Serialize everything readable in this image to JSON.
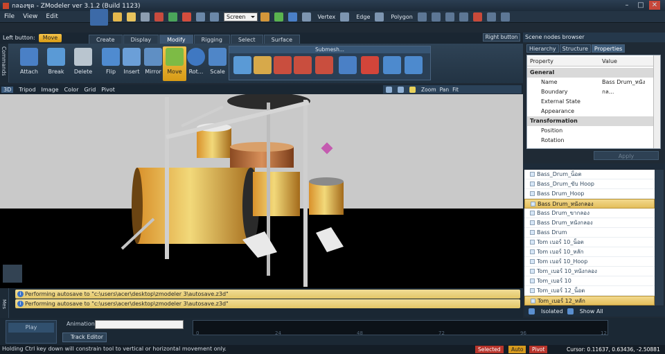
{
  "window": {
    "title": "กลองชุด - ZModeler ver 3.1.2 (Build 1123)"
  },
  "menu": [
    "File",
    "View",
    "Edit"
  ],
  "toolbar": {
    "screen_combo": "Screen",
    "selection_modes": [
      "Vertex",
      "Edge",
      "Polygon"
    ]
  },
  "left_button": {
    "label": "Left button:",
    "value": "Move"
  },
  "tabs": [
    "Create",
    "Display",
    "Modify",
    "Rigging",
    "Select",
    "Surface"
  ],
  "active_tab": "Modify",
  "right_button": "Right button",
  "commands_label": "Commands",
  "tools": [
    "Attach",
    "Break",
    "Delete",
    "Flip",
    "Insert",
    "Mirror",
    "Move",
    "Rot...",
    "Scale"
  ],
  "active_tool": "Move",
  "submesh_label": "Submesh...",
  "viewport_bar": [
    "3D",
    "Tripod",
    "Image",
    "Color",
    "Grid",
    "Pivot"
  ],
  "viewport_tools": [
    "Zoom",
    "Pan",
    "Fit"
  ],
  "log": [
    "Performing autosave to \"c:\\users\\acer\\desktop\\zmodeler 3\\autosave.z3d\"",
    "Performing autosave to \"c:\\users\\acer\\desktop\\zmodeler 3\\autosave.z3d\""
  ],
  "log_label": "Mes",
  "animation": {
    "play_label": "Play",
    "label": "Animation:",
    "track_editor": "Track Editor"
  },
  "timeline_ticks": [
    "0",
    "24",
    "48",
    "72",
    "96",
    "12"
  ],
  "status": {
    "message": "Holding Ctrl key down will constrain tool to vertical or horizontal movement only.",
    "selected": "Selected",
    "auto": "Auto",
    "pivot": "Pivot",
    "cursor": "Cursor: 0.11637, 0.63436, -2.50881"
  },
  "scene_browser": {
    "title": "Scene nodes browser",
    "tabs": [
      "Hierarchy",
      "Structure",
      "Properties"
    ],
    "active_tab": "Properties",
    "columns": [
      "Property",
      "Value"
    ],
    "props": [
      {
        "name": "General",
        "value": "",
        "group": true
      },
      {
        "name": "Name",
        "value": "Bass Drum_หนังกล...",
        "group": false
      },
      {
        "name": "Boundary",
        "value": "",
        "group": false
      },
      {
        "name": "External State",
        "value": "",
        "group": false
      },
      {
        "name": "Appearance",
        "value": "",
        "group": false
      },
      {
        "name": "Transformation",
        "value": "",
        "group": true
      },
      {
        "name": "Position",
        "value": "",
        "group": false
      },
      {
        "name": "Rotation",
        "value": "",
        "group": false
      }
    ],
    "apply": "Apply",
    "nodes": [
      "Bass_Drum_น็อต",
      "Bass_Drum_ขับ Hoop",
      "Bass Drum_Hoop",
      "Bass Drum_หนังกลอง",
      "Bass Drum_ขากลอง",
      "Bass Drum_หนังกลอง",
      "Bass Drum",
      "Tom เบอร์ 10_น็อต",
      "Tom เบอร์ 10_หลัก",
      "Tom เบอร์ 10_Hoop",
      "Tom_เบอร์ 10_หนังกลอง",
      "Tom_เบอร์ 10",
      "Tom_เบอร์ 12_น็อต",
      "Tom_เบอร์ 12_หลัก"
    ],
    "isolated": "Isolated",
    "show_all": "Show All"
  }
}
